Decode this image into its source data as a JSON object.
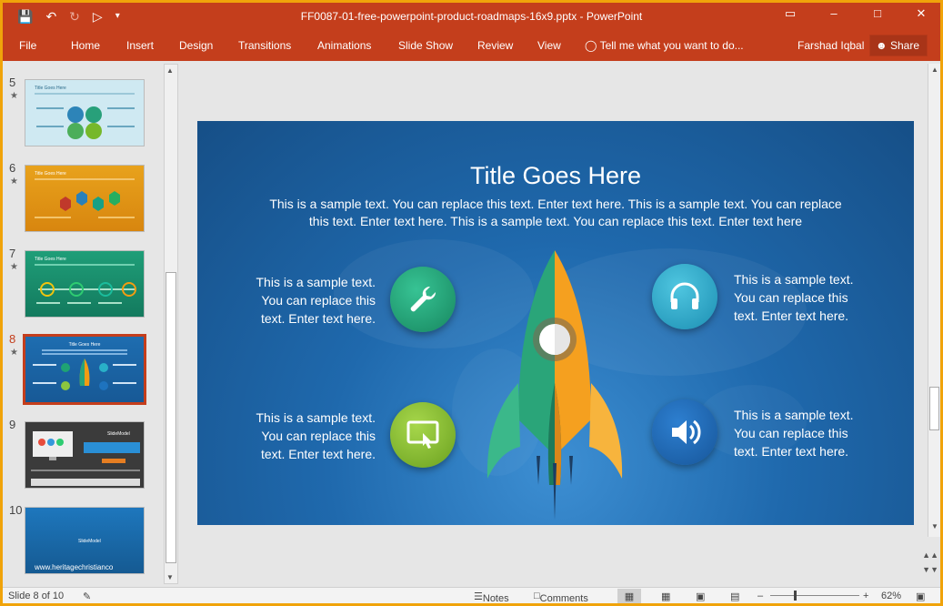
{
  "window": {
    "title": "FF0087-01-free-powerpoint-product-roadmaps-16x9.pptx - PowerPoint"
  },
  "ribbon": {
    "file": "File",
    "tabs": [
      "Home",
      "Insert",
      "Design",
      "Transitions",
      "Animations",
      "Slide Show",
      "Review",
      "View"
    ],
    "tell_me": "Tell me what you want to do...",
    "user_name": "Farshad Iqbal",
    "share": "Share"
  },
  "thumbnails": {
    "numbers": [
      "5",
      "6",
      "7",
      "8",
      "9",
      "10"
    ],
    "thumb_title": "Title Goes Here",
    "thumb10_text": "www.heritagechristianco",
    "thumb10_logo": "SlideModel",
    "thumb9_logo": "SlideModel",
    "active_index": 3
  },
  "slide": {
    "title": "Title Goes Here",
    "subtitle_line1": "This is a sample text. You can replace this text. Enter text here. This is a sample text. You can replace",
    "subtitle_line2": "this text. Enter text here. This is a sample text. You can replace this text. Enter text here",
    "block_line1": "This is a sample text.",
    "block_line2": "You can replace this",
    "block_line3": "text. Enter text here."
  },
  "status": {
    "slide_of": "Slide 8 of 10",
    "notes": "Notes",
    "comments": "Comments",
    "zoom": "62%"
  },
  "colors": {
    "accent": "#c43e1c",
    "slide_blue": "#1f69ad",
    "green": "#3aa57a",
    "orange": "#f39c12"
  }
}
